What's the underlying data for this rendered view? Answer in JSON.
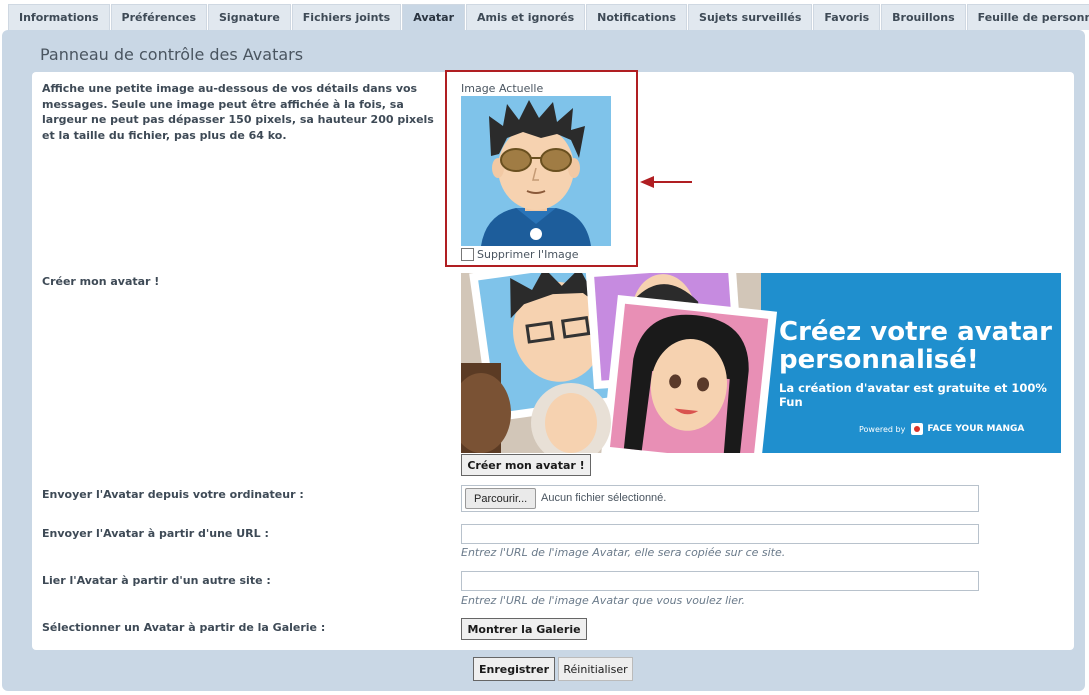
{
  "tabs": [
    {
      "label": "Informations",
      "active": false
    },
    {
      "label": "Préférences",
      "active": false
    },
    {
      "label": "Signature",
      "active": false
    },
    {
      "label": "Fichiers joints",
      "active": false
    },
    {
      "label": "Avatar",
      "active": true
    },
    {
      "label": "Amis et ignorés",
      "active": false
    },
    {
      "label": "Notifications",
      "active": false
    },
    {
      "label": "Sujets surveillés",
      "active": false
    },
    {
      "label": "Favoris",
      "active": false
    },
    {
      "label": "Brouillons",
      "active": false
    },
    {
      "label": "Feuille de personnage",
      "active": false
    }
  ],
  "panel": {
    "title": "Panneau de contrôle des Avatars",
    "description": "Affiche une petite image au-dessous de vos détails dans vos messages. Seule une image peut être affichée à la fois, sa largeur ne peut pas dépasser 150 pixels, sa hauteur 200 pixels et la taille du fichier, pas plus de 64 ko."
  },
  "current_image": {
    "label": "Image Actuelle",
    "delete_label": "Supprimer l'Image",
    "delete_checked": false
  },
  "create": {
    "label": "Créer mon avatar !",
    "banner_title_line1": "Créez votre avatar",
    "banner_title_line2": "personnalisé!",
    "banner_subtitle": "La création d'avatar est gratuite et 100% Fun",
    "banner_powered": "Powered by",
    "banner_brand": "FACE YOUR MANGA",
    "button": "Créer mon avatar !"
  },
  "upload_computer": {
    "label": "Envoyer l'Avatar depuis votre ordinateur :",
    "browse_button": "Parcourir...",
    "file_status": "Aucun fichier sélectionné."
  },
  "upload_url": {
    "label": "Envoyer l'Avatar à partir d'une URL :",
    "value": "",
    "hint": "Entrez l'URL de l'image Avatar, elle sera copiée sur ce site."
  },
  "link_url": {
    "label": "Lier l'Avatar à partir d'un autre site :",
    "value": "",
    "hint": "Entrez l'URL de l'image Avatar que vous voulez lier."
  },
  "gallery": {
    "label": "Sélectionner un Avatar à partir de la Galerie :",
    "button": "Montrer la Galerie"
  },
  "actions": {
    "save": "Enregistrer",
    "reset": "Réinitialiser"
  },
  "colors": {
    "panel_bg": "#c9d7e5",
    "highlight_border": "#b01e22",
    "banner_bg": "#1f8fce"
  }
}
